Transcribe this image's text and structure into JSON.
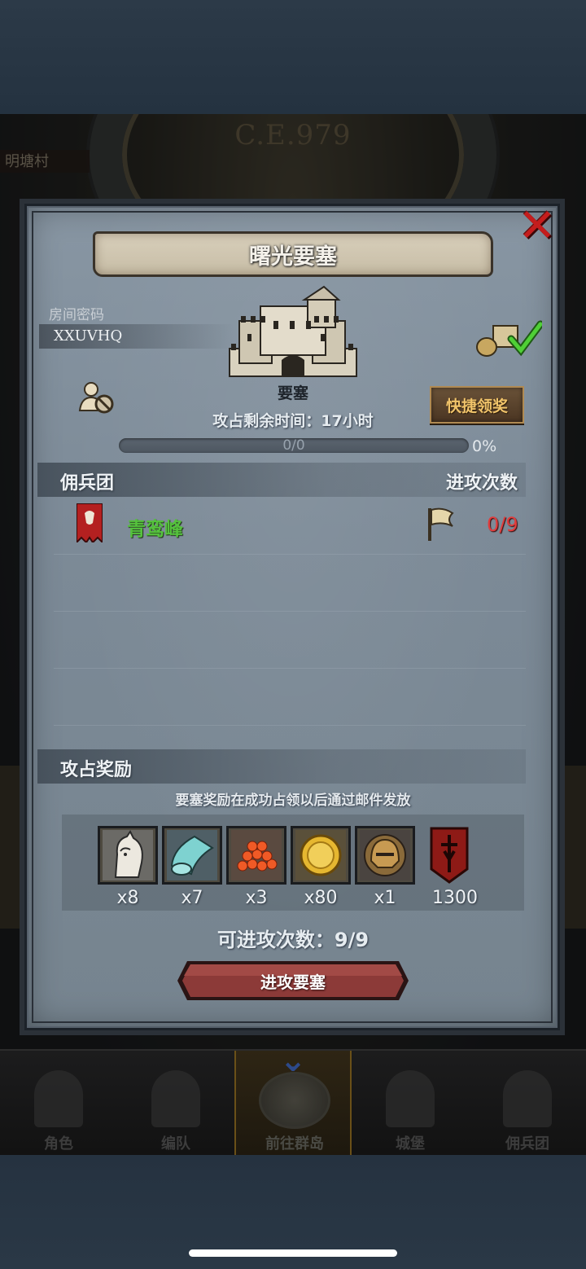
{
  "scene": {
    "year_label": "C.E.979",
    "left_label": "明塘村"
  },
  "dialog": {
    "title": "曙光要塞",
    "room_label": "房间密码",
    "room_code": "XXUVHQ",
    "fortress_type": "要塞",
    "quick_claim_label": "快捷领奖",
    "remaining_time": "攻占剩余时间：17小时",
    "progress_text": "0/0",
    "progress_percent": "0%",
    "progress_value": 0,
    "close_icon": "close-icon"
  },
  "mercenary_section": {
    "title": "佣兵团",
    "attack_count_header": "进攻次数",
    "rows": [
      {
        "guild_name": "青鸾峰",
        "attack_count": "0/9"
      }
    ]
  },
  "reward_section": {
    "title": "攻占奖励",
    "notice": "要塞奖励在成功占领以后通过邮件发放",
    "items": [
      {
        "icon": "horse-icon",
        "qty": "x8"
      },
      {
        "icon": "cloth-icon",
        "qty": "x7"
      },
      {
        "icon": "gem-pile-icon",
        "qty": "x3"
      },
      {
        "icon": "gold-coin-icon",
        "qty": "x80"
      },
      {
        "icon": "helmet-icon",
        "qty": "x1"
      },
      {
        "icon": "guild-banner-icon",
        "qty": "1300"
      }
    ],
    "attacks_left": "可进攻次数：9/9",
    "attack_button_label": "进攻要塞"
  },
  "nav": {
    "items": [
      {
        "label": "角色",
        "icon": "knight-icon"
      },
      {
        "label": "编队",
        "icon": "armor-icon"
      },
      {
        "label": "前往群岛",
        "icon": "map-icon"
      },
      {
        "label": "城堡",
        "icon": "castle-icon"
      },
      {
        "label": "佣兵团",
        "icon": "ship-icon"
      }
    ],
    "active_index": 2
  },
  "colors": {
    "guild_name": "#55c23d",
    "attack_count": "#e03d3d",
    "quick_claim_text": "#f0c36a",
    "close": "#c41d1d",
    "dialog_bg": "#7c8a97"
  }
}
